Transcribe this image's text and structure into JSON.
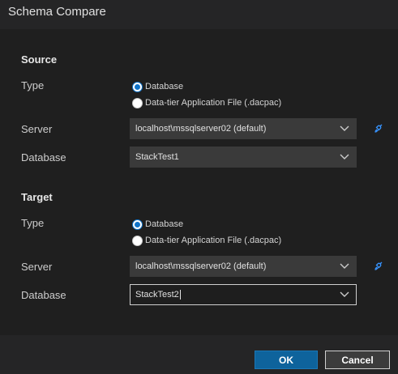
{
  "window": {
    "title": "Schema Compare"
  },
  "source": {
    "heading": "Source",
    "type_label": "Type",
    "type_options": [
      "Database",
      "Data-tier Application File (.dacpac)"
    ],
    "selected_type": "Database",
    "server_label": "Server",
    "server_value": "localhost\\mssqlserver02 (default)",
    "database_label": "Database",
    "database_value": "StackTest1"
  },
  "target": {
    "heading": "Target",
    "type_label": "Type",
    "type_options": [
      "Database",
      "Data-tier Application File (.dacpac)"
    ],
    "selected_type": "Database",
    "server_label": "Server",
    "server_value": "localhost\\mssqlserver02 (default)",
    "database_label": "Database",
    "database_value": "StackTest2"
  },
  "buttons": {
    "ok": "OK",
    "cancel": "Cancel"
  },
  "icons": {
    "dropdown": "chevron-down-icon",
    "connection": "plug-icon"
  },
  "colors": {
    "accent": "#0e639c",
    "link_icon": "#3794ff",
    "radio_selected": "#0f73c9"
  }
}
